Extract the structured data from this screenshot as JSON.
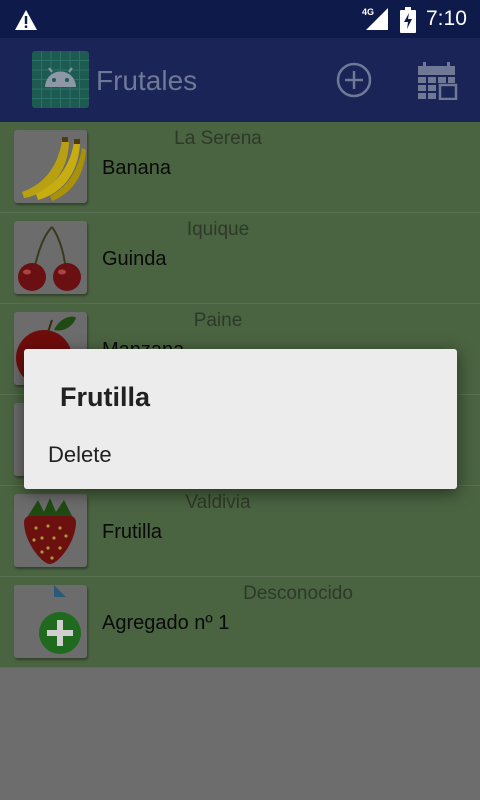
{
  "status_bar": {
    "time": "7:10",
    "network": "4G",
    "icons": [
      "warning-icon",
      "signal-icon",
      "battery-charging-icon"
    ]
  },
  "app_bar": {
    "title": "Frutales",
    "icons": [
      "android-app-icon",
      "add-circle-icon",
      "calendar-icon"
    ]
  },
  "fruits": [
    {
      "city": "La Serena",
      "name": "Banana",
      "icon": "banana-icon"
    },
    {
      "city": "Iquique",
      "name": "Guinda",
      "icon": "cherry-icon"
    },
    {
      "city": "Paine",
      "name": "Manzana",
      "icon": "apple-icon"
    },
    {
      "city": "",
      "name": "",
      "icon": "fruit-icon"
    },
    {
      "city": "Valdivia",
      "name": "Frutilla",
      "icon": "strawberry-icon"
    },
    {
      "city": "Desconocido",
      "name": "Agregado nº 1",
      "icon": "add-document-icon"
    }
  ],
  "dialog": {
    "title": "Frutilla",
    "items": [
      "Delete"
    ]
  },
  "colors": {
    "status_bar": "#0e1a4a",
    "app_bar": "#1a2457",
    "list_background": "#4a6340",
    "scrim": "#6d6d6d",
    "dialog": "#ececec"
  }
}
